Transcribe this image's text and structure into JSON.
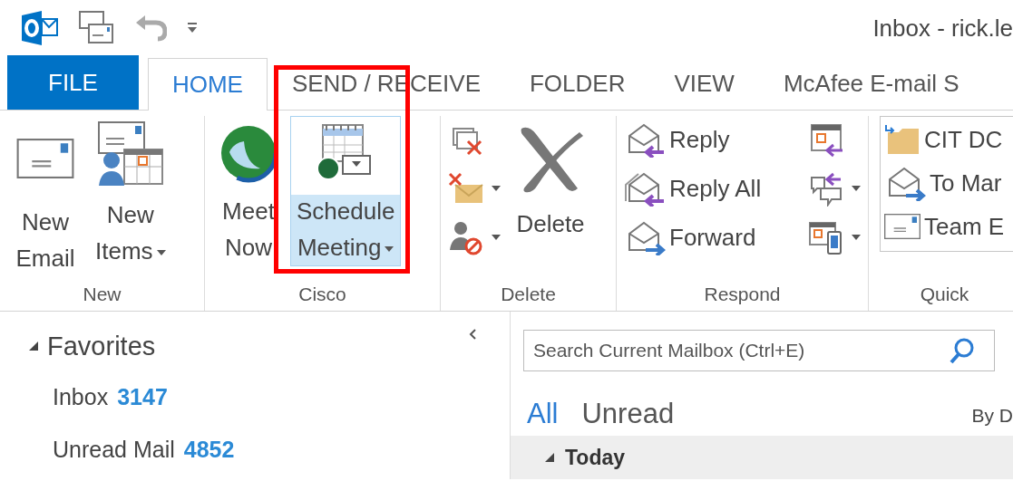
{
  "window": {
    "title": "Inbox - rick.le"
  },
  "tabs": [
    {
      "label": "FILE",
      "kind": "file",
      "selected": false
    },
    {
      "label": "HOME",
      "kind": "tab",
      "selected": true
    },
    {
      "label": "SEND / RECEIVE",
      "kind": "tab",
      "selected": false
    },
    {
      "label": "FOLDER",
      "kind": "tab",
      "selected": false
    },
    {
      "label": "VIEW",
      "kind": "tab",
      "selected": false
    },
    {
      "label": "McAfee E-mail S",
      "kind": "tab",
      "selected": false
    }
  ],
  "ribbon": {
    "groups": [
      {
        "label": "New",
        "kind": "large",
        "buttons": [
          {
            "lines": [
              "New",
              "Email"
            ],
            "dropdown": false,
            "hovered": false,
            "highlighted": false
          },
          {
            "lines": [
              "New",
              "Items"
            ],
            "dropdown": true,
            "hovered": false,
            "highlighted": false
          }
        ]
      },
      {
        "label": "Cisco",
        "kind": "large",
        "buttons": [
          {
            "lines": [
              "Meet",
              "Now"
            ],
            "dropdown": false,
            "hovered": false,
            "highlighted": false
          },
          {
            "lines": [
              "Schedule",
              "Meeting"
            ],
            "dropdown": true,
            "hovered": true,
            "highlighted": true
          }
        ]
      },
      {
        "label": "Delete",
        "kind": "delete",
        "small": [
          {
            "dropdown": false
          },
          {
            "dropdown": true
          },
          {
            "dropdown": true
          }
        ],
        "buttons": [
          {
            "lines": [
              "Delete"
            ],
            "dropdown": false,
            "hovered": false,
            "highlighted": false
          }
        ]
      },
      {
        "label": "Respond",
        "kind": "respond",
        "buttons": [
          {
            "label": "Reply"
          },
          {
            "label": "Reply All"
          },
          {
            "label": "Forward"
          }
        ],
        "small": [
          {
            "dropdown": false
          },
          {
            "dropdown": true
          },
          {
            "dropdown": true
          }
        ]
      },
      {
        "label": "Quick",
        "kind": "quick",
        "buttons": [
          {
            "label": "CIT DC"
          },
          {
            "label": "To Mar"
          },
          {
            "label": "Team E"
          }
        ]
      }
    ]
  },
  "folders": {
    "header": {
      "label": "Favorites",
      "expanded": true
    },
    "items": [
      {
        "label": "Inbox",
        "count": "3147"
      },
      {
        "label": "Unread Mail",
        "count": "4852"
      }
    ]
  },
  "search": {
    "placeholder": "Search Current Mailbox (Ctrl+E)"
  },
  "filters": [
    {
      "label": "All",
      "selected": true
    },
    {
      "label": "Unread",
      "selected": false
    }
  ],
  "sort": {
    "label": "By D"
  },
  "message_groups": [
    {
      "label": "Today",
      "expanded": true
    }
  ]
}
